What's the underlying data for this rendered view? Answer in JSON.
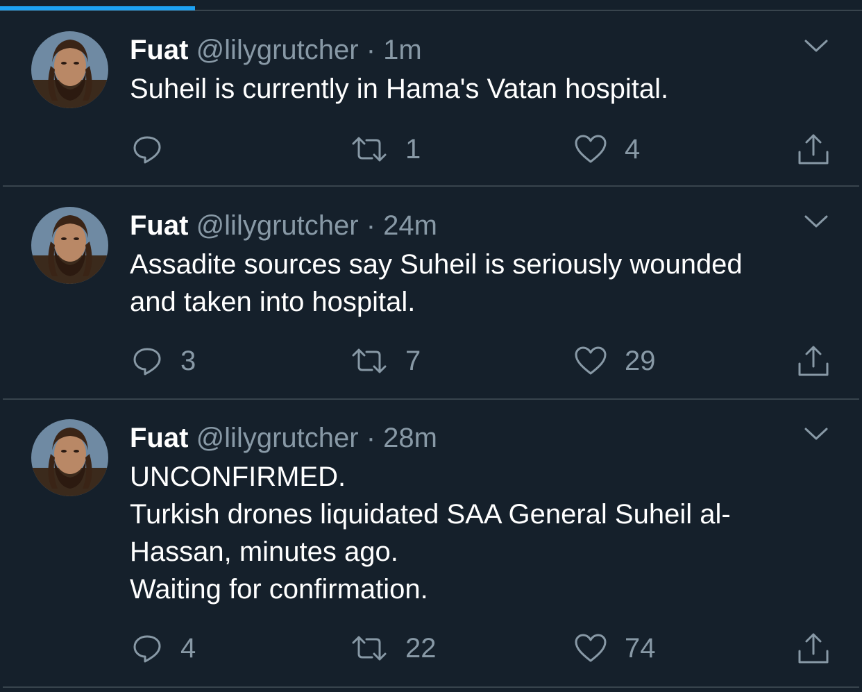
{
  "tweets": [
    {
      "name": "Fuat",
      "handle": "@lilygrutcher",
      "separator": "·",
      "time": "1m",
      "lines": [
        "Suheil is currently in Hama's Vatan hospital."
      ],
      "replies": "",
      "retweets": "1",
      "likes": "4"
    },
    {
      "name": "Fuat",
      "handle": "@lilygrutcher",
      "separator": "·",
      "time": "24m",
      "lines": [
        "Assadite sources say Suheil is seriously wounded",
        "and taken into hospital."
      ],
      "replies": "3",
      "retweets": "7",
      "likes": "29"
    },
    {
      "name": "Fuat",
      "handle": "@lilygrutcher",
      "separator": "·",
      "time": "28m",
      "lines": [
        "UNCONFIRMED.",
        "Turkish drones liquidated SAA General Suheil al-",
        "Hassan, minutes ago.",
        "Waiting for confirmation."
      ],
      "replies": "4",
      "retweets": "22",
      "likes": "74"
    }
  ],
  "icons": {
    "reply": "reply-icon",
    "retweet": "retweet-icon",
    "like": "heart-icon",
    "share": "share-icon",
    "menu": "chevron-down-icon"
  },
  "colors": {
    "background": "#15202b",
    "text": "#ffffff",
    "secondary": "#8899a6",
    "divider": "#38444d",
    "accent": "#1da1f2"
  }
}
